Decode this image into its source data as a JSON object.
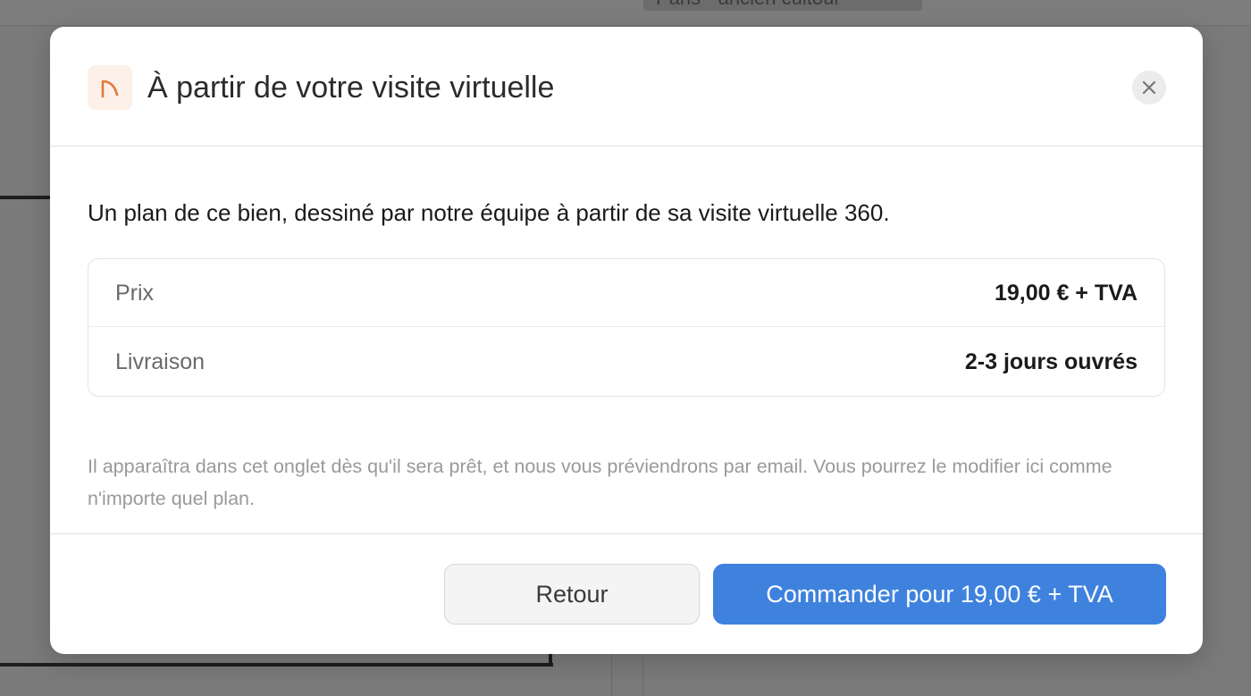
{
  "background": {
    "chip_text": "Paris - ancien cultour"
  },
  "modal": {
    "icon": "floor-plan-arc-icon",
    "accent_color": "#e07a3c",
    "title": "À partir de votre visite virtuelle",
    "close_icon": "close-icon"
  },
  "body": {
    "lead": "Un plan de ce bien, dessiné par notre équipe à partir de sa visite virtuelle 360.",
    "rows": [
      {
        "label": "Prix",
        "value": "19,00 € + TVA"
      },
      {
        "label": "Livraison",
        "value": "2-3 jours ouvrés"
      }
    ],
    "note": "Il apparaîtra dans cet onglet dès qu'il sera prêt, et nous vous préviendrons par email. Vous pourrez le modifier ici comme n'importe quel plan."
  },
  "footer": {
    "back_label": "Retour",
    "order_label": "Commander pour 19,00 € + TVA",
    "primary_color": "#3f82de"
  }
}
